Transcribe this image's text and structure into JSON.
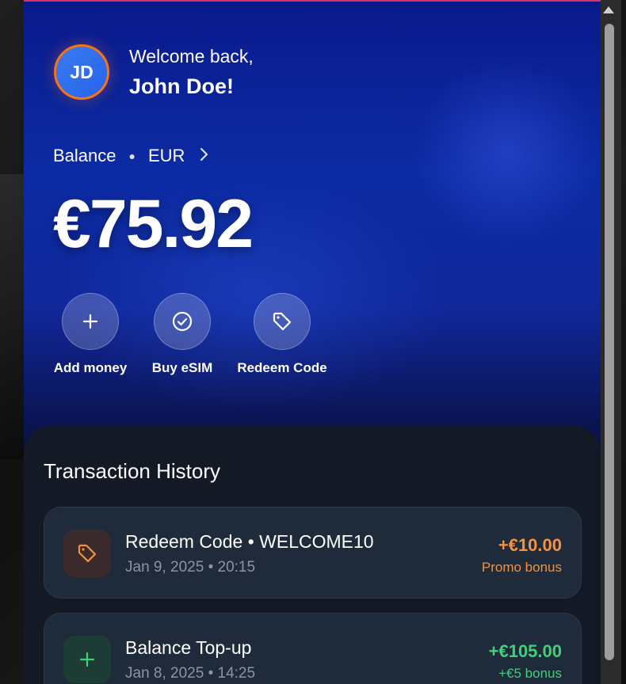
{
  "user": {
    "initials": "JD",
    "greeting": "Welcome back,",
    "name": "John Doe!"
  },
  "balance": {
    "label": "Balance",
    "currency": "EUR",
    "amount": "€75.92"
  },
  "actions": [
    {
      "label": "Add money",
      "icon": "plus-icon"
    },
    {
      "label": "Buy eSIM",
      "icon": "check-circle-icon"
    },
    {
      "label": "Redeem Code",
      "icon": "tag-icon"
    }
  ],
  "history": {
    "title": "Transaction History",
    "items": [
      {
        "title": "Redeem Code • WELCOME10",
        "date": "Jan 9, 2025 • 20:15",
        "amount": "+€10.00",
        "note": "Promo bonus",
        "icon": "tag-icon",
        "color": "#f5923b"
      },
      {
        "title": "Balance Top-up",
        "date": "Jan 8, 2025 • 14:25",
        "amount": "+€105.00",
        "note": "+€5 bonus",
        "icon": "plus-icon",
        "color": "#3fd17a"
      }
    ]
  },
  "colors": {
    "accent": "#f97316",
    "primary": "#0c2ba3",
    "sheet": "#131a26"
  }
}
